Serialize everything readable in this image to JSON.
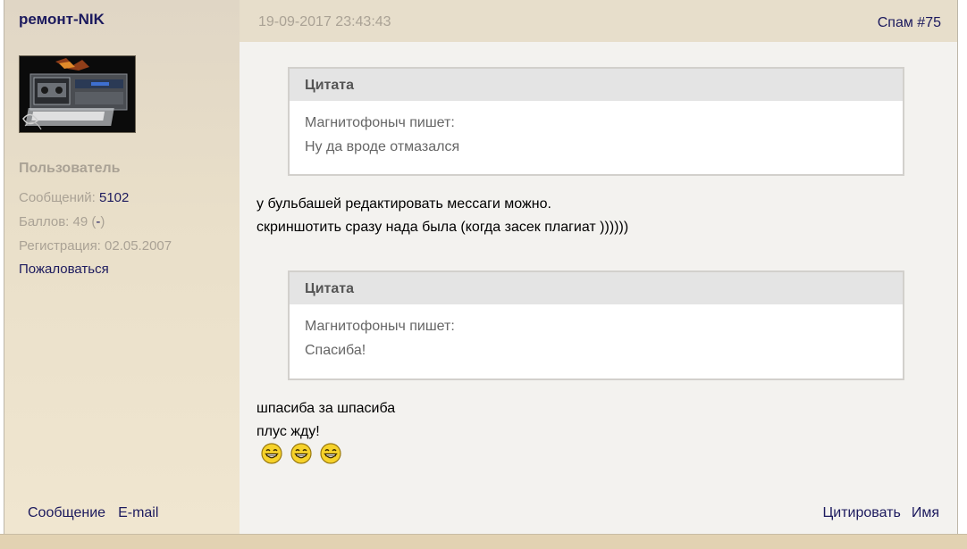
{
  "user": {
    "name": "ремонт-NIK",
    "rank": "Пользователь",
    "messages_label": "Сообщений: ",
    "messages_value": "5102",
    "points_label": "Баллов: 49 (",
    "points_link": "-",
    "points_close": ")",
    "registration": "Регистрация: 02.05.2007",
    "report_link": "Пожаловаться",
    "message_link": "Сообщение",
    "email_link": "E-mail"
  },
  "post": {
    "date": "19-09-2017 23:43:43",
    "number": "Спам #75",
    "quotes": [
      {
        "title": "Цитата",
        "author": "Магнитофоныч  пишет:",
        "text": "Ну да вроде отмазался"
      },
      {
        "title": "Цитата",
        "author": "Магнитофоныч  пишет:",
        "text": "Спасиба!"
      }
    ],
    "text1": [
      "у бульбашей редактировать мессаги можно.",
      "скриншотить сразу нада была (когда засек плагиат ))))))"
    ],
    "text2": [
      "шпасиба за шпасиба",
      "плус жду!"
    ],
    "smileys": [
      "grin-smiley-icon",
      "grin-smiley-icon",
      "grin-smiley-icon"
    ],
    "actions": {
      "quote": "Цитировать",
      "name": "Имя"
    }
  },
  "colors": {
    "link": "#1c1a5e",
    "muted": "#aaa295",
    "sidebar_bg": "#e9dfc9",
    "header_bg": "#e7decb"
  }
}
